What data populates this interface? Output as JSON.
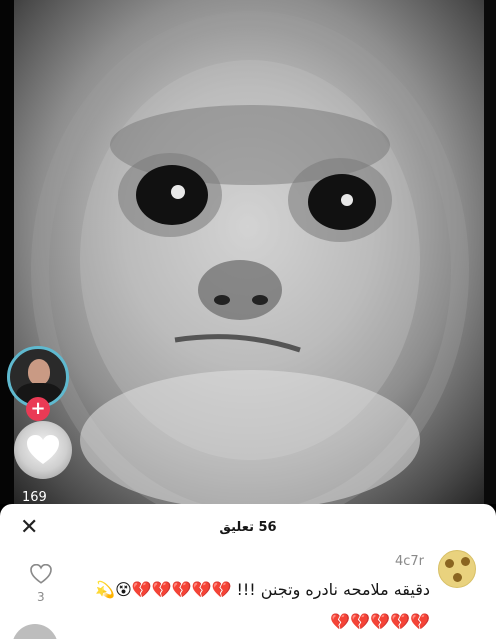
{
  "video": {
    "creator_follow_symbol": "+",
    "like_count": "169"
  },
  "comments": {
    "title": "56 تعليق",
    "close_symbol": "✕",
    "items": [
      {
        "username": "4c7r",
        "text": "دقيقه ملامحه نادره وتجنن !!!",
        "emoji_line1": "💔💔💔💔💔😵💫",
        "emoji_line2": "💔💔💔💔💔",
        "likes": "3"
      }
    ]
  }
}
